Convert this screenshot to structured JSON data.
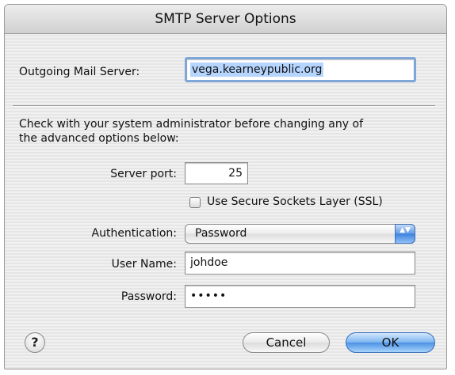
{
  "window": {
    "title": "SMTP Server Options"
  },
  "outgoing": {
    "label": "Outgoing Mail Server:",
    "value": "vega.kearneypublic.org"
  },
  "notice": {
    "line1": "Check with your system administrator before changing any of",
    "line2": "the advanced options below:"
  },
  "port": {
    "label": "Server port:",
    "value": "25"
  },
  "ssl": {
    "label": "Use Secure Sockets Layer (SSL)",
    "checked": false
  },
  "auth": {
    "label": "Authentication:",
    "value": "Password",
    "arrows": "▲▼"
  },
  "username": {
    "label": "User Name:",
    "value": "johdoe"
  },
  "password": {
    "label": "Password:",
    "value": "•••••"
  },
  "buttons": {
    "help": "?",
    "cancel": "Cancel",
    "ok": "OK"
  },
  "colors": {
    "focus_ring": "#7ea6d8",
    "selection": "#b5d5ff",
    "default_button": "#4b91e3"
  }
}
